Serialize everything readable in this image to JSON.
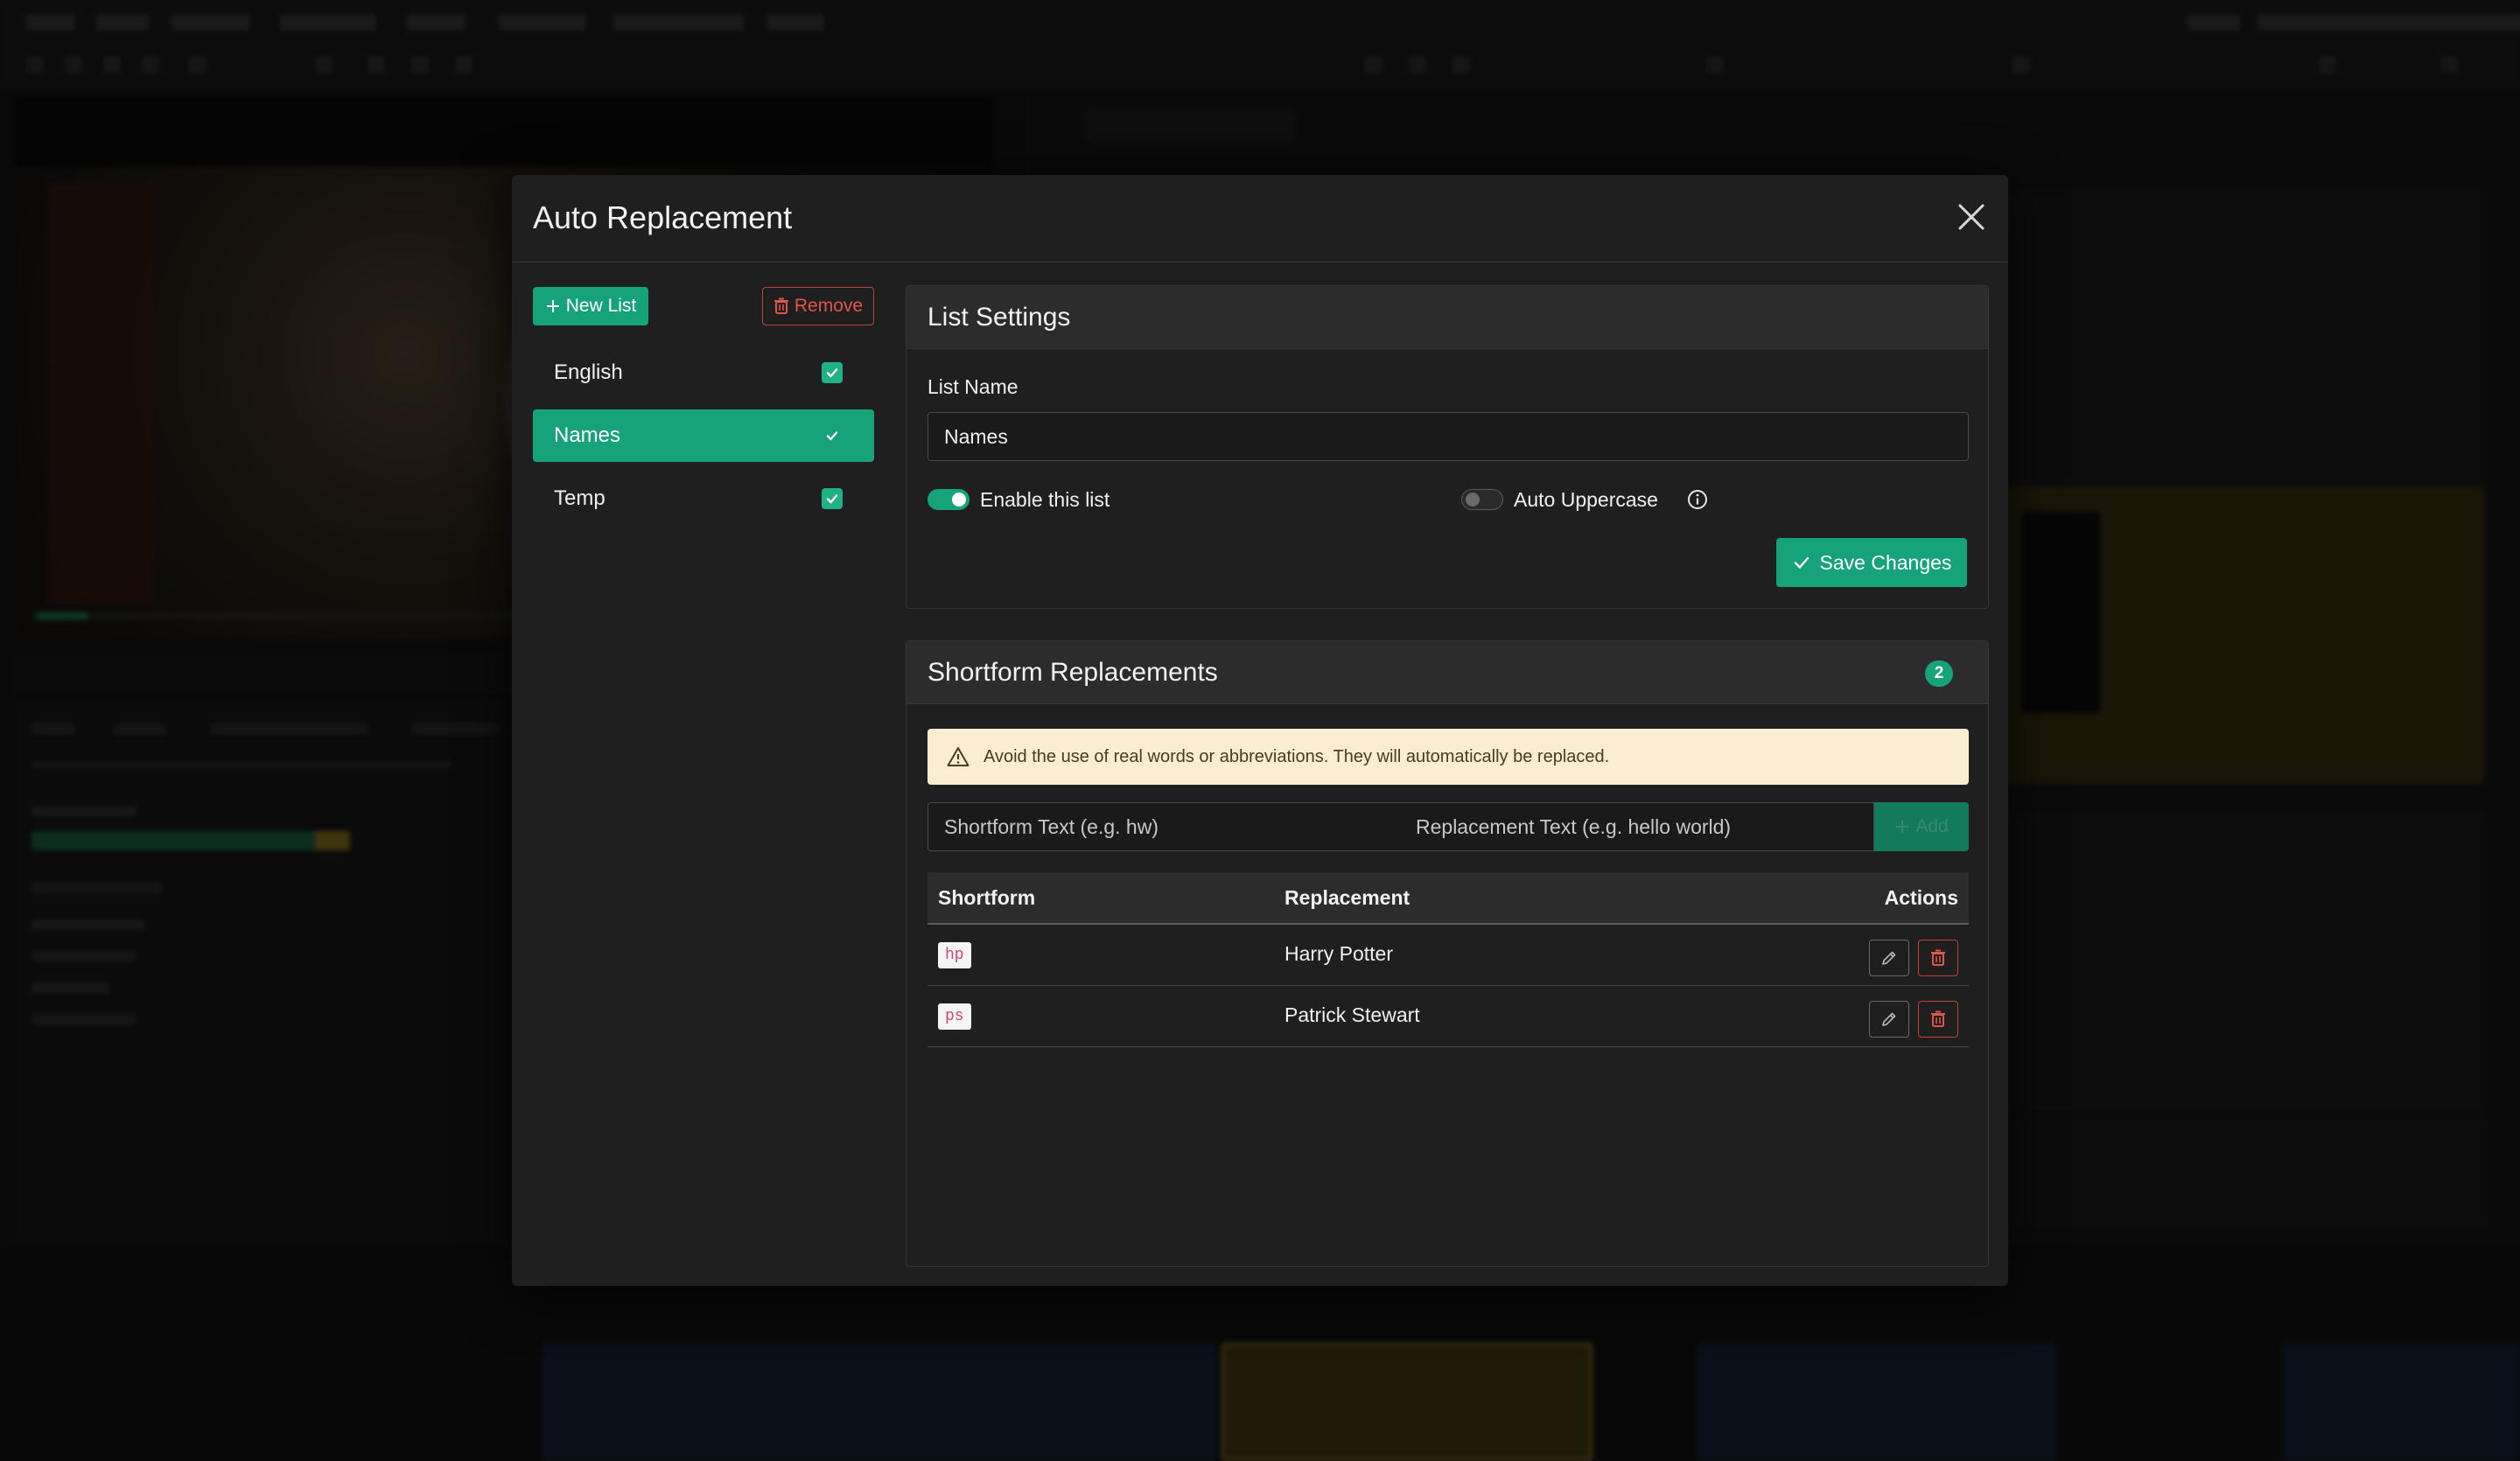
{
  "modal": {
    "title": "Auto Replacement"
  },
  "lists_panel": {
    "new_list_label": "New List",
    "remove_label": "Remove",
    "items": [
      {
        "label": "English",
        "enabled": true,
        "active": false
      },
      {
        "label": "Names",
        "enabled": true,
        "active": true
      },
      {
        "label": "Temp",
        "enabled": true,
        "active": false
      }
    ]
  },
  "list_settings": {
    "title": "List Settings",
    "list_name_label": "List Name",
    "list_name_value": "Names",
    "enable_label": "Enable this list",
    "enable_on": true,
    "uppercase_label": "Auto Uppercase",
    "uppercase_on": false,
    "save_label": "Save Changes"
  },
  "shortform": {
    "title": "Shortform Replacements",
    "count": "2",
    "warning": "Avoid the use of real words or abbreviations. They will automatically be replaced.",
    "shortform_placeholder": "Shortform Text (e.g. hw)",
    "replacement_placeholder": "Replacement Text (e.g. hello world)",
    "add_label": "Add",
    "columns": {
      "shortform": "Shortform",
      "replacement": "Replacement",
      "actions": "Actions"
    },
    "rows": [
      {
        "shortform": "hp",
        "replacement": "Harry Potter"
      },
      {
        "shortform": "ps",
        "replacement": "Patrick Stewart"
      }
    ]
  },
  "colors": {
    "accent": "#17a37a",
    "danger": "#c0443a",
    "warning_bg": "#fcecd0",
    "modal_bg": "#1f1f1f"
  }
}
